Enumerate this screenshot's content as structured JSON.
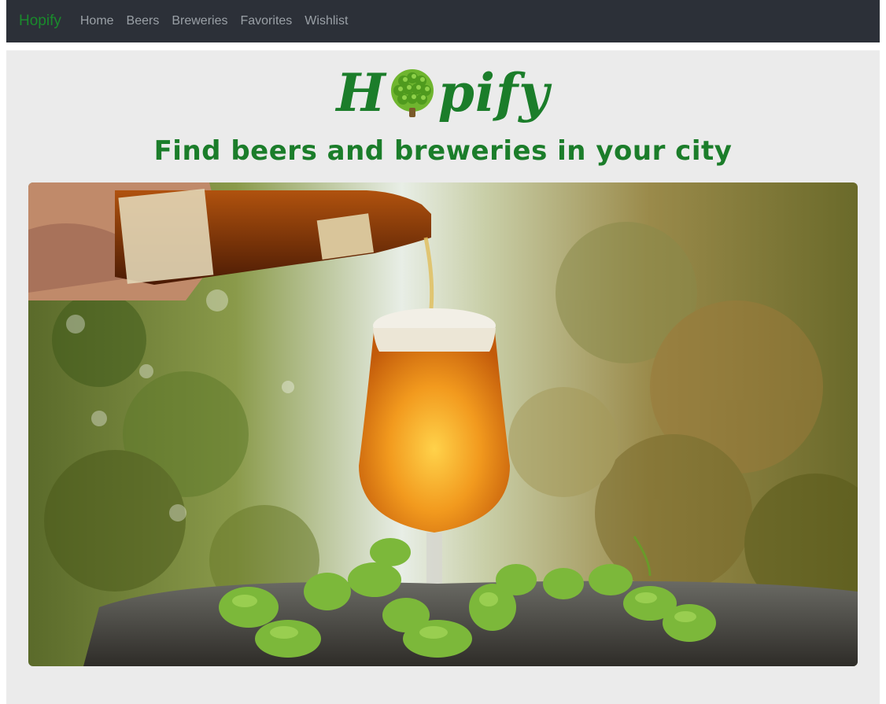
{
  "navbar": {
    "brand": "Hopify",
    "links": [
      "Home",
      "Beers",
      "Breweries",
      "Favorites",
      "Wishlist"
    ]
  },
  "header": {
    "logo_text_left": "H",
    "logo_text_right": "pify",
    "tagline": "Find beers and breweries in your city"
  },
  "hero": {
    "image_description_icon": "beer-pour-photo"
  },
  "colors": {
    "brand_green": "#1b7d2a",
    "navbar_bg": "#2c3038",
    "page_bg": "#ebebeb"
  }
}
